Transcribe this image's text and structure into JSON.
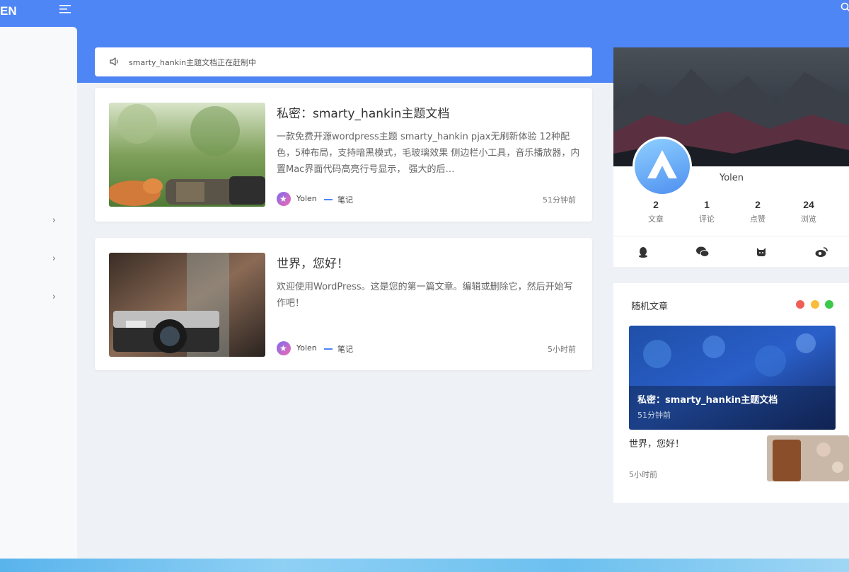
{
  "header": {
    "logo": "EN",
    "menu_icon": "menu-toggle-icon",
    "search_icon": "search-icon",
    "accent": "#4e86f6"
  },
  "sidebar": {
    "items": [
      {
        "chevron": "›"
      },
      {
        "chevron": "›"
      },
      {
        "chevron": "›"
      }
    ]
  },
  "notice": {
    "icon": "volume-icon",
    "text": "smarty_hankin主题文档正在赶制中"
  },
  "posts": [
    {
      "title": "私密：smarty_hankin主题文档",
      "excerpt": "一款免费开源wordpress主题 smarty_hankin pjax无刷新体验 12种配色，5种布局，支持暗黑模式，毛玻璃效果 侧边栏小工具，音乐播放器，内置Mac界面代码高亮行号显示， 强大的后…",
      "author": "Yolen",
      "category": "笔记",
      "time": "51分钟前"
    },
    {
      "title": "世界，您好！",
      "excerpt": "欢迎使用WordPress。这是您的第一篇文章。编辑或删除它，然后开始写作吧！",
      "author": "Yolen",
      "category": "笔记",
      "time": "5小时前"
    }
  ],
  "profile": {
    "name": "Yolen",
    "stats": [
      {
        "value": "2",
        "label": "文章"
      },
      {
        "value": "1",
        "label": "评论"
      },
      {
        "value": "2",
        "label": "点赞"
      },
      {
        "value": "24",
        "label": "浏览"
      }
    ],
    "social_icons": [
      "qq-icon",
      "wechat-icon",
      "github-icon",
      "weibo-icon"
    ]
  },
  "random_posts": {
    "title": "随机文章",
    "window_dots": [
      "#ef5f58",
      "#f7bd3c",
      "#3cc84a"
    ],
    "featured": {
      "title": "私密：smarty_hankin主题文档",
      "time": "51分钟前"
    },
    "item": {
      "title": "世界，您好！",
      "time": "5小时前"
    }
  }
}
